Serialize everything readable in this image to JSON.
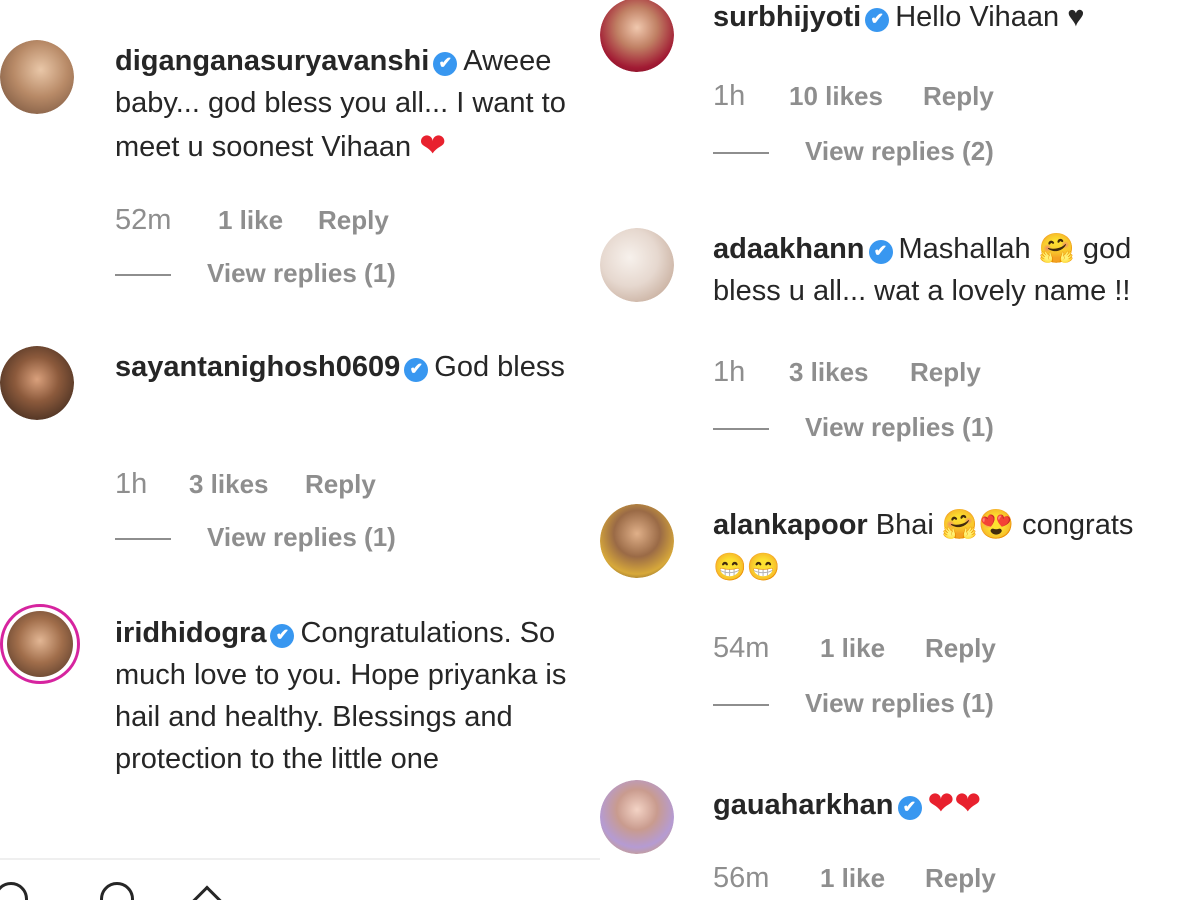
{
  "left_column": [
    {
      "username": "diganganasuryavanshi",
      "verified": true,
      "text": "Aweee baby... god bless you all... I want to meet u soonest Vihaan",
      "emoji": "❤",
      "time": "52m",
      "likes": "1 like",
      "reply": "Reply",
      "view_replies": "View replies (1)"
    },
    {
      "username": "sayantanighosh0609",
      "verified": true,
      "text": "God bless",
      "time": "1h",
      "likes": "3 likes",
      "reply": "Reply",
      "view_replies": "View replies (1)"
    },
    {
      "username": "iridhidogra",
      "verified": true,
      "text": "Congratulations. So much love to you. Hope priyanka is hail and healthy. Blessings and protection to the little one"
    }
  ],
  "right_column": [
    {
      "username": "surbhijyoti",
      "verified": true,
      "text": "Hello Vihaan ♥",
      "time": "1h",
      "likes": "10 likes",
      "reply": "Reply",
      "view_replies": "View replies (2)"
    },
    {
      "username": "adaakhann",
      "verified": true,
      "text": "Mashallah 🤗 god bless u all... wat a lovely name !!",
      "time": "1h",
      "likes": "3 likes",
      "reply": "Reply",
      "view_replies": "View replies (1)"
    },
    {
      "username": "alankapoor",
      "verified": false,
      "text": "Bhai 🤗😍 congrats",
      "text2": "😁😁",
      "time": "54m",
      "likes": "1 like",
      "reply": "Reply",
      "view_replies": "View replies (1)"
    },
    {
      "username": "gauaharkhan",
      "verified": true,
      "text": "❤❤",
      "time": "56m",
      "likes": "1 like",
      "reply": "Reply"
    }
  ],
  "icons": {
    "verified": "✔"
  },
  "colors": {
    "verified": "#3897f0",
    "muted": "#8e8e8e",
    "text": "#262626",
    "story_ring": "#d6249f"
  }
}
